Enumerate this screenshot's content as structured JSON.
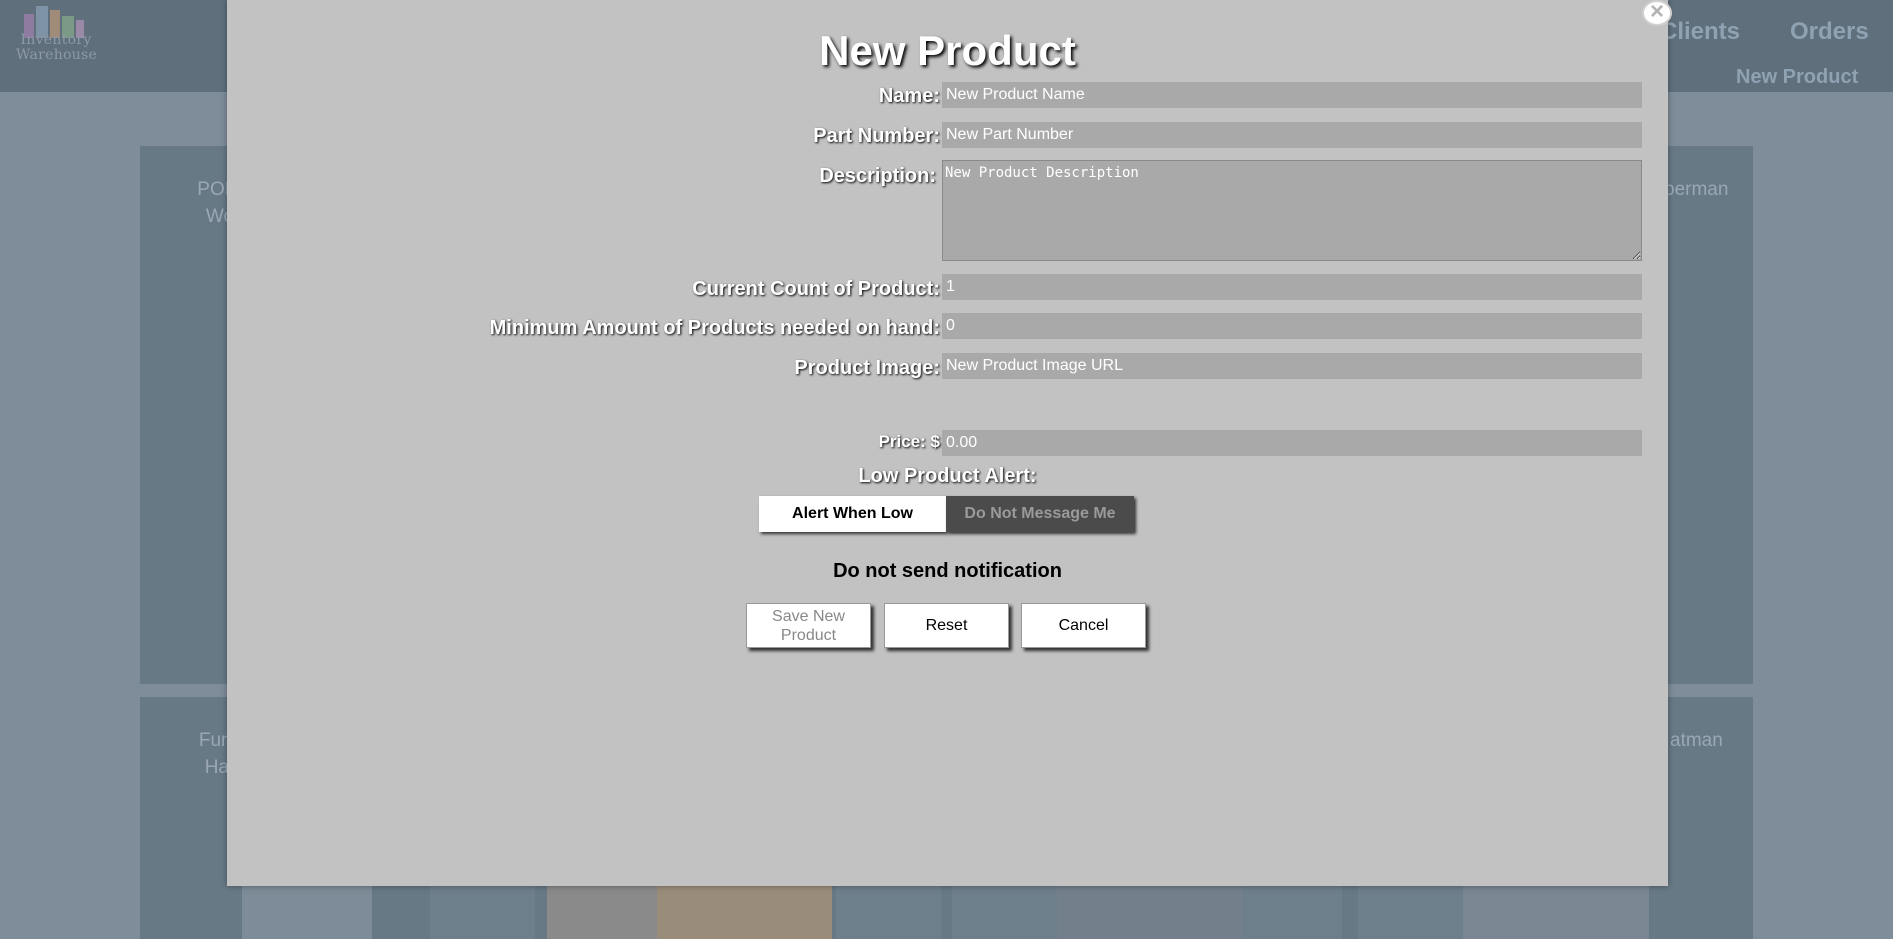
{
  "background": {
    "logo_text": "Inventory\nWarehouse",
    "nav": {
      "clients": "Clients",
      "orders": "Orders",
      "sub": "New Product"
    },
    "cards": [
      {
        "left_text": "POP!\nWo",
        "right_text": "perman"
      },
      {
        "left_text": "Funk\nHar",
        "right_text": "atman"
      }
    ]
  },
  "modal": {
    "close_icon": "×",
    "title": "New Product",
    "labels": {
      "name": "Name:",
      "part_number": "Part Number:",
      "description": "Description:",
      "current_count": "Current Count of Product:",
      "minimum": "Minimum Amount of Products needed on hand:",
      "image": "Product Image:",
      "price": "Price: $"
    },
    "fields": {
      "name": "New Product Name",
      "part_number": "New Part Number",
      "description": "New Product Description",
      "current_count": "1",
      "minimum": "0",
      "image": "New Product Image URL",
      "price": "0.00"
    },
    "alert": {
      "title": "Low Product Alert:",
      "option_on": "Alert When Low",
      "option_off": "Do Not Message Me",
      "status": "Do not send notification"
    },
    "buttons": {
      "save": "Save New Product",
      "reset": "Reset",
      "cancel": "Cancel"
    }
  },
  "colors": {
    "backdrop": "#7e8d99",
    "modal": "#c2c2c2",
    "field": "#a9a9a9",
    "toggle_off": "#4b4b4b"
  }
}
